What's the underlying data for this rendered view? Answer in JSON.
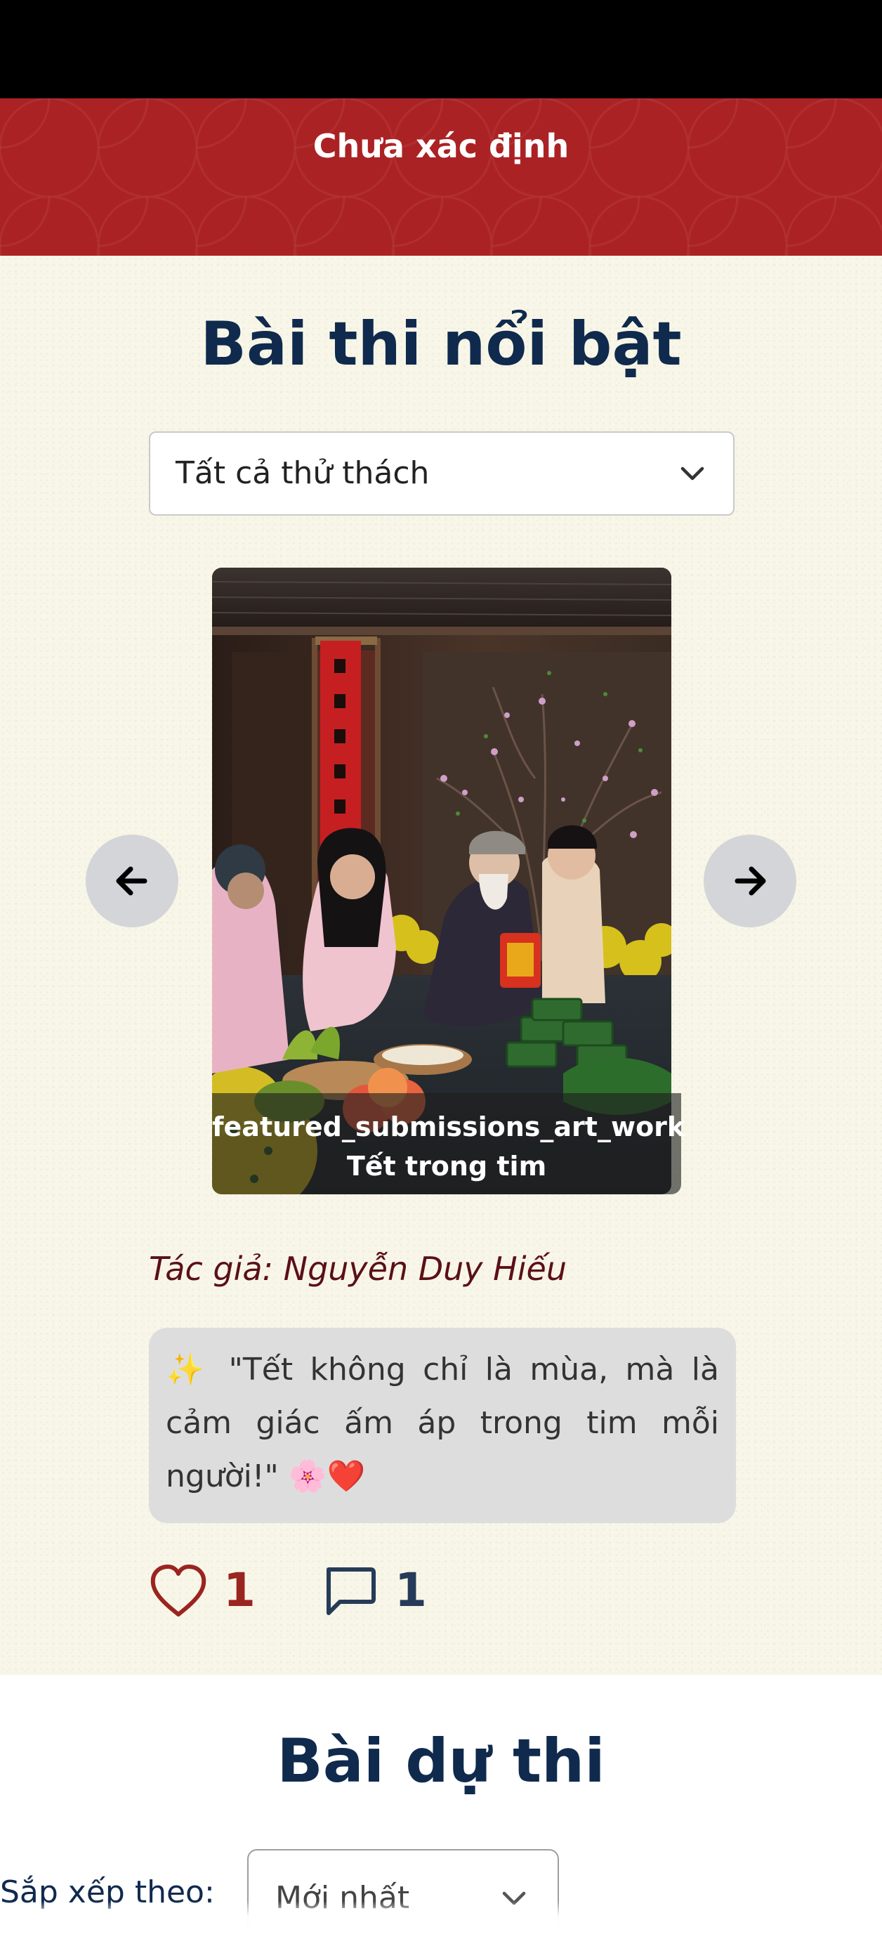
{
  "header": {
    "title": "Chưa xác định"
  },
  "featured": {
    "heading": "Bài thi nổi bật",
    "challenge_filter": {
      "selected": "Tất cả thử thách"
    },
    "carousel": {
      "caption_line1": "featured_submissions_art_work",
      "caption_line2": "Tết trong tim"
    },
    "author": "Tác giả: Nguyễn Duy Hiếu",
    "quote": "✨ \"Tết không chỉ là mùa, mà là cảm giác ấm áp trong tim mỗi người!\" 🌸❤️",
    "likes": "1",
    "comments": "1"
  },
  "entries": {
    "heading": "Bài dự thi",
    "sort_label": "Sắp xếp theo:",
    "sort_selected": "Mới nhất"
  },
  "colors": {
    "header_red": "#ab2224",
    "navy": "#0f2a4d",
    "like_red": "#9a2420",
    "paper": "#f8f6e8"
  },
  "icons": {
    "select_chevron": "chevron-down-icon",
    "prev": "arrow-left-icon",
    "next": "arrow-right-icon",
    "like": "heart-icon",
    "comment": "comment-icon"
  }
}
